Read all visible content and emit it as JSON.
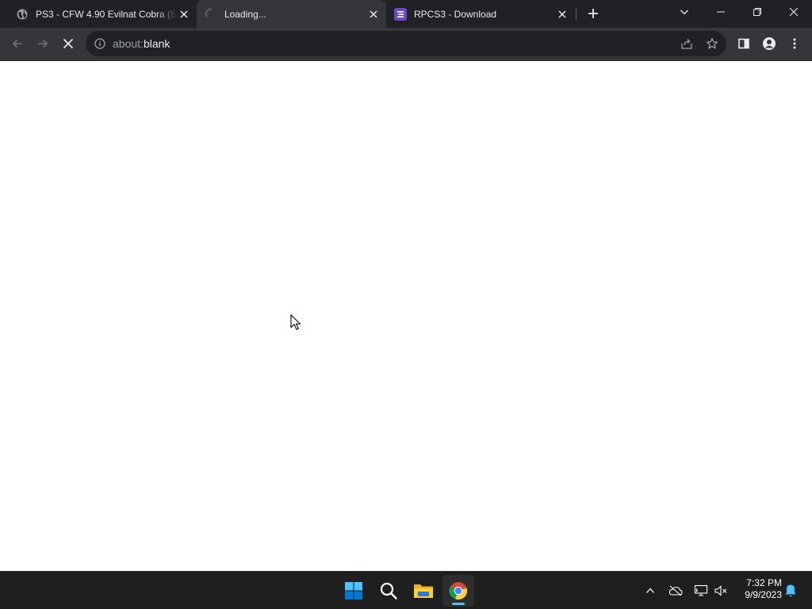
{
  "browser": {
    "tabs": [
      {
        "title": "PS3 - CFW 4.90 Evilnat Cobra (8.4",
        "favicon": "globe-icon",
        "active": false
      },
      {
        "title": "Loading...",
        "favicon": "loading-spinner-icon",
        "active": true
      },
      {
        "title": "RPCS3 - Download",
        "favicon": "rpcs3-logo-icon",
        "active": false
      }
    ],
    "address_bar": {
      "scheme": "about:",
      "host": "blank"
    }
  },
  "taskbar": {
    "apps": [
      "windows-start-icon",
      "search-icon",
      "file-explorer-icon",
      "chrome-icon"
    ],
    "clock": {
      "time": "7:32 PM",
      "date": "9/9/2023"
    }
  },
  "colors": {
    "tab_strip": "#202124",
    "toolbar": "#35363a",
    "omnibox": "#202124",
    "taskbar": "#1f1f1f",
    "accent": "#4cc2ff",
    "rpcs3_brand": "#6a4bc4"
  }
}
